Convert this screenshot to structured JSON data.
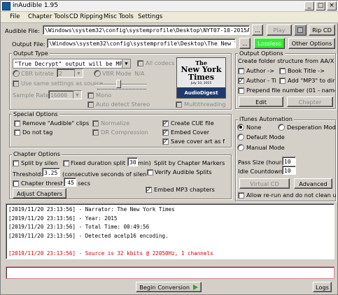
{
  "window": {
    "title": "inAudible 1.95",
    "minimize": "_",
    "maximize": "□",
    "close": "×"
  },
  "menu": [
    "File",
    "Chapter Tools",
    "CD Ripping",
    "Misc Tools",
    "Settings"
  ],
  "audible_file": {
    "label": "Audible File:",
    "value": "\\Windows\\system32\\config\\systemprofile\\Desktop\\NYT07-10-2015AudioDig",
    "browse": "...",
    "play": "Play",
    "rip": "Rip CD"
  },
  "output_file": {
    "label": "Output File:",
    "value": "\\Windows\\system32\\config\\systemprofile\\Desktop\\The New York Tim•",
    "browse": "...",
    "lossless": "Lossless",
    "other": "Other Options"
  },
  "output_type": {
    "title": "Output Type",
    "format": "\"True Decrypt\" output will be MP3",
    "all_codecs": "All codecs",
    "cbr_label": "CBR bitrate",
    "cbr_value": "2",
    "vbr_label": "VBR Mode",
    "vbr_value": "N/A",
    "use_same": "Use same settings as source",
    "sample_rate_label": "Sample Rate",
    "sample_rate_value": "16000",
    "mono": "Mono",
    "auto_stereo": "Auto detect Stereo",
    "multithreading": "Multithreading"
  },
  "cover": {
    "line1": "The",
    "line2": "New York",
    "line3": "Times",
    "date": "July 10, 2015",
    "footer": "AudioDigest"
  },
  "output_options": {
    "title": "Output Options",
    "create_label": "Create folder structure from AA/X",
    "author": "Author ->",
    "book_title": "Book Title ->",
    "author_title": "Author - Ti",
    "add_mp3": "Add \"MP3\" to dir",
    "prepend": "Prepend file number (01 - name",
    "edit": "Edit",
    "chapter": "Chapter"
  },
  "special": {
    "title": "Special Options",
    "remove_audible": "Remove \"Audible\" clips",
    "normalize": "Normalize",
    "create_cue": "Create CUE file",
    "do_not_tag": "Do not tag",
    "drc": "DR Compression",
    "embed_cover": "Embed Cover",
    "save_cover": "Save cover art as f"
  },
  "itunes": {
    "title": "iTunes Automation",
    "none": "None",
    "desperation": "Desperation Mode",
    "default": "Default Mode",
    "manual": "Manual Mode",
    "pass_size_label": "Pass Size (hours",
    "pass_size_value": "10",
    "idle_label": "Idle Countdown",
    "idle_value": "10",
    "virtual_cd": "Virtual CD",
    "advanced": "Advanced",
    "allow_rerun": "Allow re-run and do not clean u"
  },
  "chapter": {
    "title": "Chapter Options",
    "split_by_silence": "Split by silen",
    "fixed_duration": "Fixed duration split",
    "fixed_value": "30",
    "min_suffix": "min)",
    "split_markers": "Split by Chapter Markers",
    "threshold_label": "Threshold:",
    "threshold_value": "3.25",
    "threshold_desc": "(consecutive seconds of silen",
    "verify": "Verify Audible Splits",
    "chapter_thresh": "Chapter thresh",
    "chapter_thresh_value": "45",
    "secs": "secs",
    "adjust": "Adjust Chapters",
    "embed_mp3": "Embed MP3 chapters"
  },
  "log": [
    {
      "text": "[2019/11/20 23:13:56] - Narrator: The New York Times",
      "color": "#000000"
    },
    {
      "text": "[2019/11/20 23:13:56] - Year: 2015",
      "color": "#000000"
    },
    {
      "text": "[2019/11/20 23:13:56] - Total Time: 00:49:56",
      "color": "#000000"
    },
    {
      "text": "[2019/11/20 23:13:56] - Detected acelp16 encoding.",
      "color": "#000000"
    },
    {
      "text": "",
      "color": "#000000"
    },
    {
      "text": "[2019/11/20 23:13:56] - Source is 32 kbits @ 22050Hz, 1 channels",
      "color": "#cc0000"
    }
  ],
  "bottom": {
    "begin": "Begin Conversion",
    "logs": "Logs"
  },
  "colors": {
    "lossless_bg": "#33ee33",
    "error_text": "#cc0000",
    "arrow": "#22aa22"
  }
}
